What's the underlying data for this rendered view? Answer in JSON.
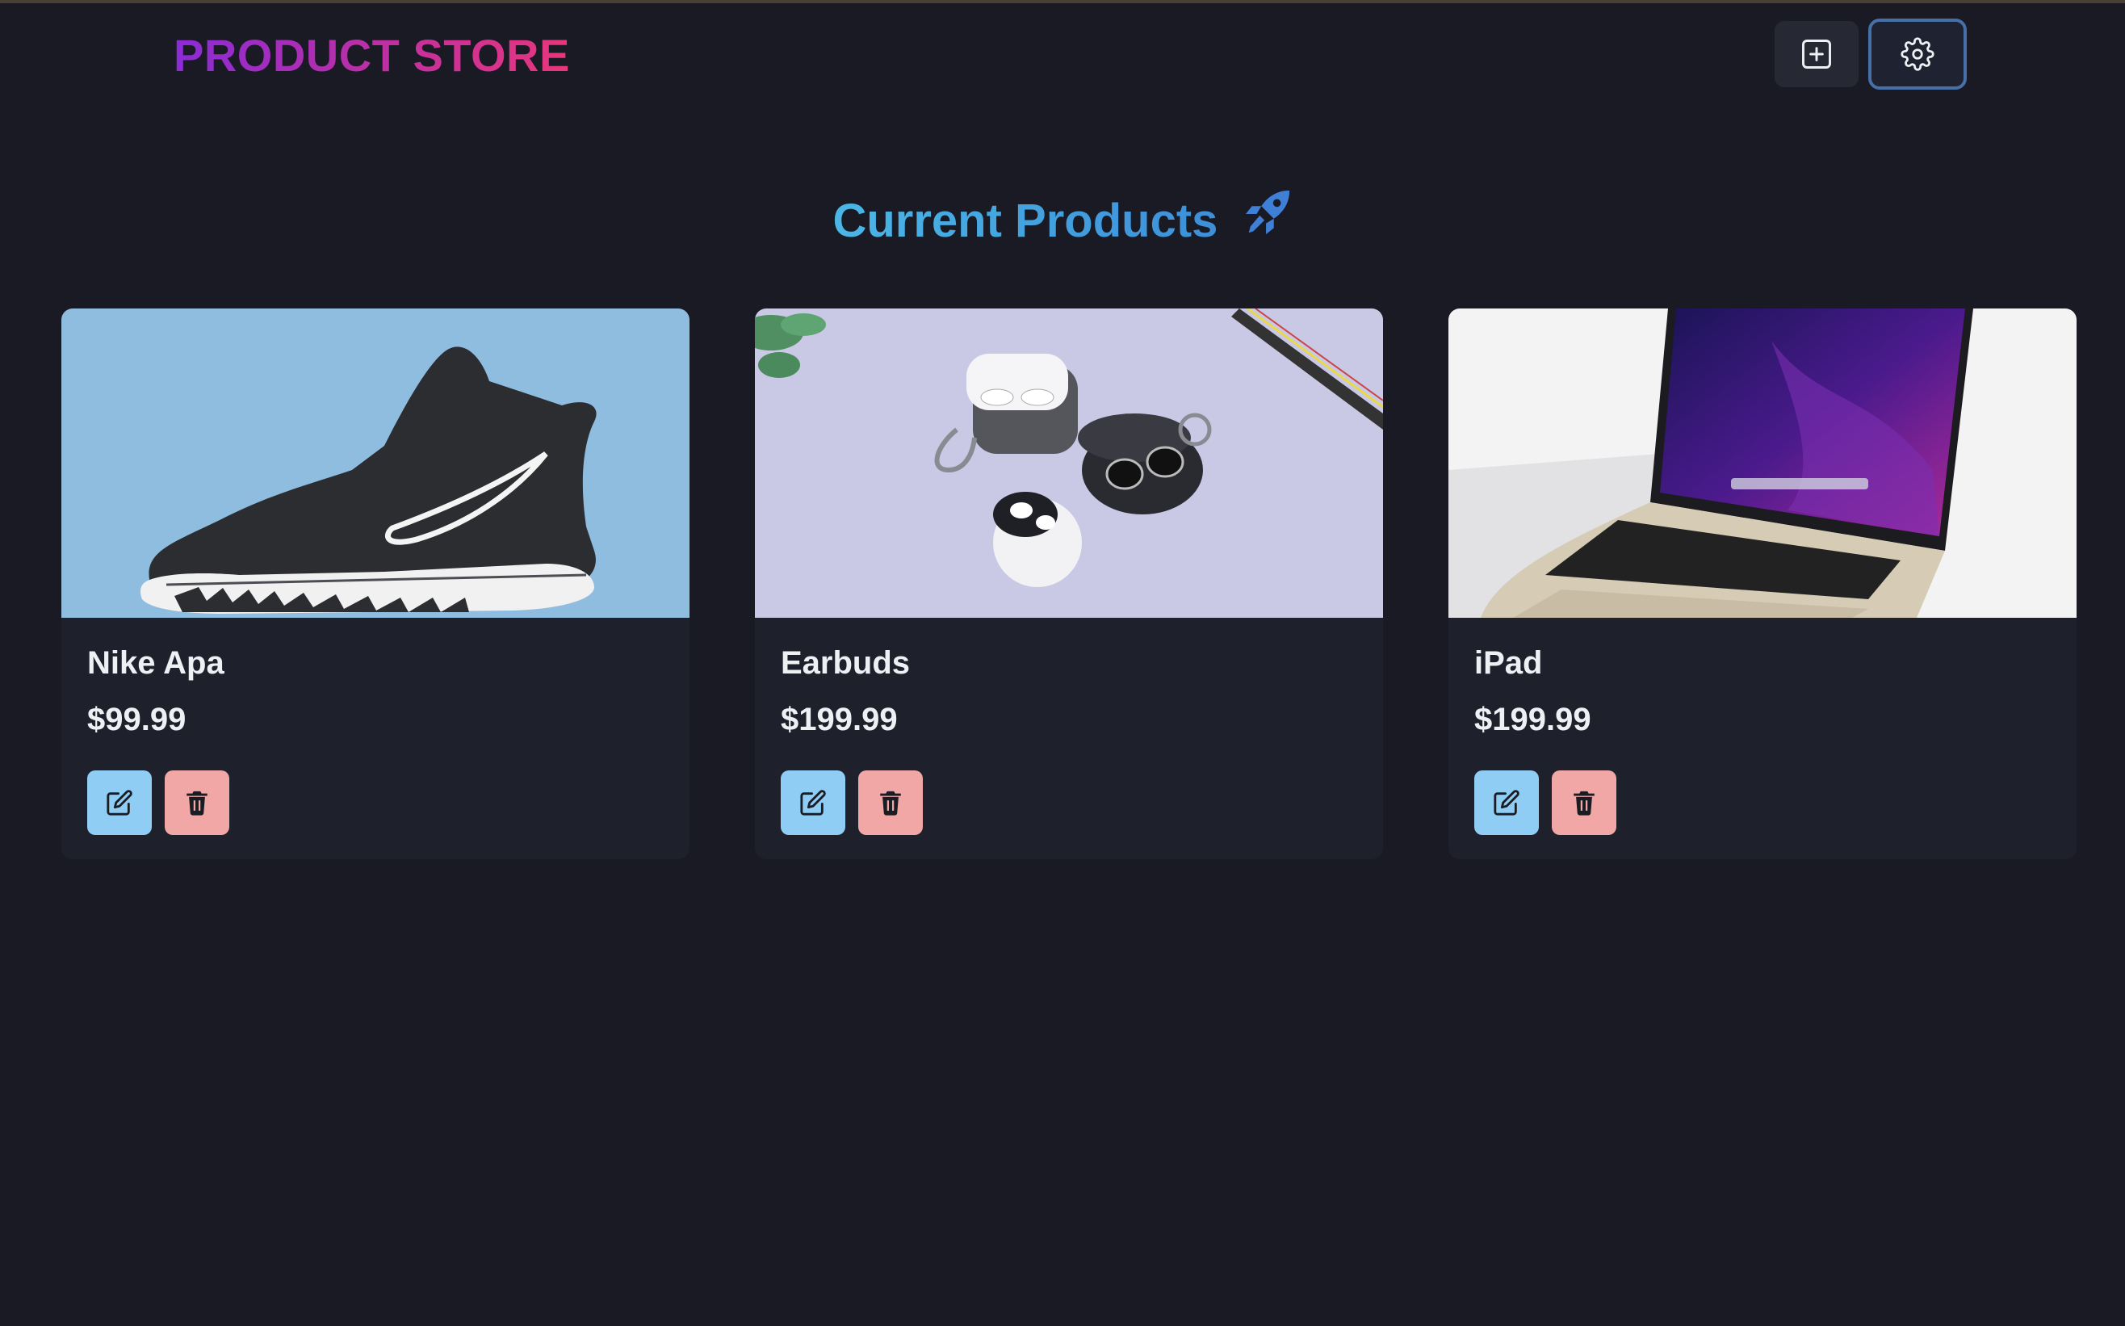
{
  "header": {
    "brand": "PRODUCT STORE",
    "add_icon": "plus-square-icon",
    "settings_icon": "gear-icon"
  },
  "main": {
    "title": "Current Products",
    "title_icon": "rocket-icon"
  },
  "products": [
    {
      "name": "Nike Apa",
      "price": "$99.99",
      "image": "sneaker-photo"
    },
    {
      "name": "Earbuds",
      "price": "$199.99",
      "image": "earbuds-photo"
    },
    {
      "name": "iPad",
      "price": "$199.99",
      "image": "laptop-photo"
    }
  ],
  "colors": {
    "background": "#191a24",
    "card": "#1e212c",
    "edit_button": "#90cdf4",
    "delete_button": "#f2a7a7",
    "settings_border": "#4671a8"
  }
}
